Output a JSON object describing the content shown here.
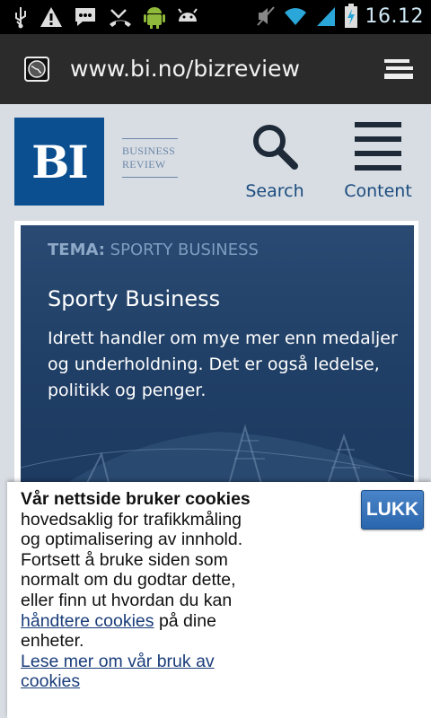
{
  "status_bar": {
    "time": "16.12",
    "icons": [
      "usb-icon",
      "warning-icon",
      "message-icon",
      "missed-call-icon",
      "android-icon",
      "android-icon",
      "mute-icon",
      "wifi-icon",
      "signal-icon",
      "battery-charging-icon"
    ]
  },
  "browser": {
    "url": "www.bi.no/bizreview"
  },
  "header": {
    "logo_text": "BI",
    "logo_sub_line1": "BUSINESS",
    "logo_sub_line2": "REVIEW",
    "search_label": "Search",
    "content_label": "Content"
  },
  "hero": {
    "tema_label": "TEMA:",
    "tema_value": " SPORTY BUSINESS",
    "title": "Sporty Business",
    "text": "Idrett handler om mye mer enn medaljer og underholdning. Det er også ledelse, politikk og penger."
  },
  "cookie": {
    "bold_text": "Vår nettside bruker cookies",
    "text_1": " hovedsaklig for trafikkmåling og optimalisering av innhold. Fortsett å bruke siden som normalt om du godtar dette, eller finn ut hvordan du kan ",
    "link_manage": "håndtere cookies",
    "text_2": " på dine enheter.",
    "link_more": "Lese mer om vår bruk av cookies",
    "close_label": "LUKK"
  },
  "colors": {
    "brand_blue": "#0b4f91",
    "hero_bg": "#203f66",
    "link_color": "#1b4c7e",
    "button_blue": "#2a66ad"
  }
}
